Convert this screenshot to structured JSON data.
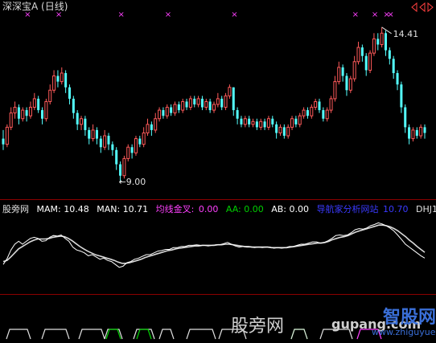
{
  "window": {
    "title": "深深宝A (日线)"
  },
  "colors": {
    "up": "#ff5a5a",
    "down": "#54ffff",
    "mam_line": "#ffffff",
    "man_line": "#ffffff",
    "signal_x": "#ff40ff",
    "separator": "#8b0000",
    "dhj1": "#e0e0e0",
    "gold_line": "#ff40ff",
    "aa_line": "#00d000"
  },
  "indicator": {
    "name": "股旁网",
    "mam_label": "MAM: 10.48",
    "man_label": "MAN: 10.71",
    "gold_label": "均线金叉:",
    "gold_value": "0.00",
    "aa_label": "AA: 0.00",
    "ab_label": "AB: 0.00",
    "site_label": "导航家分析网站",
    "site_value": "10.70",
    "dhj1_label": "DHJ1"
  },
  "watermark": {
    "cn": "股旁网",
    "domain": "gupang.com",
    "logo_text": "智股网",
    "logo_domain": "www.zhiguyue.com"
  },
  "chart_data": [
    {
      "type": "candlestick",
      "title": "深深宝A (日线)",
      "annotations": [
        {
          "text": "14.41",
          "kind": "high"
        },
        {
          "text": "9.00",
          "kind": "low"
        }
      ],
      "high_label": "14.41",
      "low_label": "9.00",
      "ylim": [
        8.6,
        14.8
      ],
      "candles": [
        [
          10.5,
          10.3,
          10.8,
          10.1
        ],
        [
          10.3,
          10.9,
          11.0,
          10.2
        ],
        [
          10.9,
          11.4,
          11.6,
          10.8
        ],
        [
          11.4,
          11.6,
          11.8,
          11.2
        ],
        [
          11.6,
          11.2,
          11.7,
          11.0
        ],
        [
          11.2,
          11.5,
          11.6,
          11.1
        ],
        [
          11.5,
          11.3,
          11.6,
          11.1
        ],
        [
          11.3,
          11.6,
          11.8,
          11.2
        ],
        [
          11.6,
          11.9,
          12.1,
          11.5
        ],
        [
          11.9,
          11.5,
          12.0,
          11.4
        ],
        [
          11.5,
          11.2,
          11.6,
          11.0
        ],
        [
          11.2,
          11.8,
          11.9,
          11.1
        ],
        [
          11.8,
          12.2,
          12.4,
          11.7
        ],
        [
          12.2,
          12.7,
          12.9,
          12.1
        ],
        [
          12.7,
          12.5,
          12.9,
          12.3
        ],
        [
          12.5,
          12.8,
          13.0,
          12.4
        ],
        [
          12.8,
          12.3,
          12.9,
          12.1
        ],
        [
          12.3,
          11.9,
          12.4,
          11.7
        ],
        [
          11.9,
          11.4,
          12.0,
          11.2
        ],
        [
          11.4,
          11.0,
          11.5,
          10.8
        ],
        [
          11.0,
          11.2,
          11.3,
          10.8
        ],
        [
          11.2,
          10.8,
          11.3,
          10.6
        ],
        [
          10.8,
          10.5,
          10.9,
          10.3
        ],
        [
          10.5,
          10.8,
          11.0,
          10.4
        ],
        [
          10.8,
          10.5,
          10.9,
          10.3
        ],
        [
          10.5,
          10.2,
          10.6,
          10.0
        ],
        [
          10.2,
          10.6,
          10.8,
          10.1
        ],
        [
          10.6,
          10.3,
          10.7,
          10.1
        ],
        [
          10.3,
          10.1,
          10.4,
          9.9
        ],
        [
          10.1,
          9.6,
          10.2,
          9.4
        ],
        [
          9.6,
          9.2,
          9.7,
          9.0
        ],
        [
          9.2,
          9.8,
          9.9,
          9.1
        ],
        [
          9.8,
          10.2,
          10.3,
          9.7
        ],
        [
          10.2,
          10.0,
          10.3,
          9.8
        ],
        [
          10.0,
          10.5,
          10.6,
          9.9
        ],
        [
          10.5,
          10.3,
          10.6,
          10.2
        ],
        [
          10.3,
          10.7,
          10.9,
          10.2
        ],
        [
          10.7,
          11.0,
          11.2,
          10.6
        ],
        [
          11.0,
          10.8,
          11.1,
          10.6
        ],
        [
          10.8,
          11.2,
          11.4,
          10.7
        ],
        [
          11.2,
          11.5,
          11.6,
          11.1
        ],
        [
          11.5,
          11.3,
          11.6,
          11.2
        ],
        [
          11.3,
          11.6,
          11.7,
          11.2
        ],
        [
          11.6,
          11.4,
          11.7,
          11.3
        ],
        [
          11.4,
          11.7,
          11.8,
          11.3
        ],
        [
          11.7,
          11.5,
          11.8,
          11.4
        ],
        [
          11.5,
          11.8,
          11.9,
          11.4
        ],
        [
          11.8,
          11.6,
          11.9,
          11.5
        ],
        [
          11.6,
          11.9,
          12.0,
          11.5
        ],
        [
          11.9,
          11.7,
          12.0,
          11.6
        ],
        [
          11.7,
          11.9,
          12.0,
          11.6
        ],
        [
          11.9,
          11.6,
          12.0,
          11.5
        ],
        [
          11.6,
          11.8,
          11.9,
          11.5
        ],
        [
          11.8,
          11.5,
          11.9,
          11.4
        ],
        [
          11.5,
          11.7,
          11.8,
          11.4
        ],
        [
          11.7,
          11.9,
          12.1,
          11.6
        ],
        [
          11.9,
          11.6,
          12.0,
          11.5
        ],
        [
          11.6,
          12.0,
          12.1,
          11.5
        ],
        [
          12.0,
          12.3,
          12.4,
          11.9
        ],
        [
          12.3,
          11.5,
          12.3,
          11.3
        ],
        [
          11.5,
          11.2,
          11.6,
          11.0
        ],
        [
          11.2,
          11.0,
          11.3,
          10.9
        ],
        [
          11.0,
          11.2,
          11.3,
          10.9
        ],
        [
          11.2,
          11.0,
          11.3,
          10.9
        ],
        [
          11.0,
          11.1,
          11.2,
          10.9
        ],
        [
          11.1,
          10.9,
          11.2,
          10.8
        ],
        [
          10.9,
          11.1,
          11.2,
          10.8
        ],
        [
          11.1,
          10.9,
          11.2,
          10.8
        ],
        [
          10.9,
          11.2,
          11.3,
          10.8
        ],
        [
          11.2,
          11.0,
          11.3,
          10.9
        ],
        [
          11.0,
          10.7,
          11.1,
          10.5
        ],
        [
          10.7,
          10.9,
          11.0,
          10.6
        ],
        [
          10.9,
          10.6,
          11.0,
          10.5
        ],
        [
          10.6,
          10.9,
          11.0,
          10.5
        ],
        [
          10.9,
          11.2,
          11.3,
          10.8
        ],
        [
          11.2,
          11.0,
          11.3,
          10.9
        ],
        [
          11.0,
          11.3,
          11.4,
          10.9
        ],
        [
          11.3,
          11.5,
          11.6,
          11.2
        ],
        [
          11.5,
          11.3,
          11.6,
          11.2
        ],
        [
          11.3,
          11.6,
          11.7,
          11.2
        ],
        [
          11.6,
          11.8,
          11.9,
          11.5
        ],
        [
          11.8,
          11.5,
          11.9,
          11.4
        ],
        [
          11.5,
          11.2,
          11.6,
          11.1
        ],
        [
          11.2,
          11.5,
          11.6,
          11.1
        ],
        [
          11.5,
          11.9,
          12.0,
          11.4
        ],
        [
          11.9,
          12.5,
          12.7,
          11.8
        ],
        [
          12.5,
          13.0,
          13.2,
          12.4
        ],
        [
          13.0,
          12.7,
          13.1,
          12.5
        ],
        [
          12.7,
          12.2,
          12.8,
          12.0
        ],
        [
          12.2,
          12.6,
          12.7,
          12.1
        ],
        [
          12.6,
          13.2,
          13.4,
          12.5
        ],
        [
          13.2,
          13.7,
          13.9,
          13.1
        ],
        [
          13.7,
          13.4,
          13.8,
          13.2
        ],
        [
          13.4,
          12.9,
          13.5,
          12.7
        ],
        [
          12.9,
          13.5,
          13.6,
          12.8
        ],
        [
          13.5,
          14.0,
          14.2,
          13.4
        ],
        [
          14.0,
          13.8,
          14.2,
          13.6
        ],
        [
          13.8,
          14.2,
          14.41,
          13.7
        ],
        [
          14.2,
          13.6,
          14.3,
          13.4
        ],
        [
          13.6,
          13.3,
          13.7,
          13.1
        ],
        [
          13.3,
          12.8,
          13.4,
          12.6
        ],
        [
          12.8,
          12.4,
          12.9,
          12.2
        ],
        [
          12.4,
          11.6,
          12.5,
          11.4
        ],
        [
          11.6,
          10.9,
          11.7,
          10.7
        ],
        [
          10.9,
          10.5,
          11.0,
          10.3
        ],
        [
          10.5,
          10.8,
          10.9,
          10.4
        ],
        [
          10.8,
          10.6,
          10.9,
          10.5
        ],
        [
          10.6,
          10.9,
          11.0,
          10.5
        ],
        [
          10.9,
          10.7,
          11.0,
          10.5
        ]
      ],
      "signal_marks": [
        6,
        14,
        30,
        42,
        59,
        90,
        95,
        98,
        99
      ]
    },
    {
      "type": "line",
      "title": "股旁网",
      "series": [
        {
          "name": "MAM",
          "values": [
            -3.5,
            -2.5,
            -1,
            0,
            0.5,
            0,
            0.5,
            1,
            1.2,
            1,
            0.5,
            0.6,
            1.2,
            1.5,
            1.4,
            1.6,
            1,
            0.5,
            -0.5,
            -1,
            -1.2,
            -1.5,
            -2,
            -1.8,
            -2.2,
            -2.6,
            -2.4,
            -2.8,
            -3,
            -3.5,
            -4,
            -3.8,
            -3.2,
            -3,
            -2.6,
            -2.4,
            -2.1,
            -1.8,
            -1.8,
            -1.5,
            -1.2,
            -1.1,
            -0.9,
            -0.9,
            -0.6,
            -0.6,
            -0.4,
            -0.4,
            -0.2,
            -0.2,
            -0.1,
            -0.2,
            -0.2,
            -0.3,
            -0.2,
            -0.1,
            -0.1,
            0.1,
            0.3,
            0,
            -0.3,
            -0.5,
            -0.4,
            -0.5,
            -0.5,
            -0.6,
            -0.5,
            -0.6,
            -0.5,
            -0.5,
            -0.7,
            -0.6,
            -0.7,
            -0.6,
            -0.4,
            -0.4,
            -0.2,
            0,
            0,
            0.2,
            0.4,
            0.4,
            0.2,
            0.3,
            0.6,
            1,
            1.5,
            1.6,
            1.5,
            1.6,
            2,
            2.5,
            2.7,
            2.6,
            2.8,
            3.2,
            3.4,
            3.7,
            3.5,
            3.2,
            2.8,
            2.3,
            1.6,
            0.8,
            0,
            -0.5,
            -1,
            -1.5,
            -2,
            -2.4
          ]
        },
        {
          "name": "MAN",
          "values": [
            -3,
            -2.8,
            -2.2,
            -1.5,
            -0.8,
            -0.4,
            0,
            0.4,
            0.7,
            0.9,
            0.9,
            0.9,
            1,
            1.2,
            1.3,
            1.4,
            1.3,
            1,
            0.6,
            0.1,
            -0.4,
            -0.8,
            -1.2,
            -1.5,
            -1.8,
            -2,
            -2.2,
            -2.4,
            -2.6,
            -2.8,
            -3.1,
            -3.3,
            -3.3,
            -3.2,
            -3,
            -2.8,
            -2.6,
            -2.3,
            -2.1,
            -1.9,
            -1.7,
            -1.5,
            -1.3,
            -1.1,
            -1,
            -0.8,
            -0.7,
            -0.6,
            -0.5,
            -0.4,
            -0.3,
            -0.3,
            -0.2,
            -0.2,
            -0.2,
            -0.2,
            -0.1,
            -0.1,
            0,
            0,
            -0.1,
            -0.2,
            -0.3,
            -0.4,
            -0.4,
            -0.5,
            -0.5,
            -0.5,
            -0.5,
            -0.5,
            -0.6,
            -0.6,
            -0.6,
            -0.6,
            -0.6,
            -0.5,
            -0.4,
            -0.3,
            -0.2,
            -0.1,
            0,
            0.1,
            0.2,
            0.2,
            0.3,
            0.5,
            0.8,
            1,
            1.2,
            1.3,
            1.5,
            1.8,
            2.1,
            2.3,
            2.5,
            2.7,
            2.9,
            3.1,
            3.3,
            3.3,
            3.2,
            3,
            2.7,
            2.3,
            1.8,
            1.3,
            0.7,
            0.2,
            -0.4,
            -0.9,
            -1.4
          ]
        }
      ],
      "ylim": [
        -5,
        5
      ]
    }
  ]
}
